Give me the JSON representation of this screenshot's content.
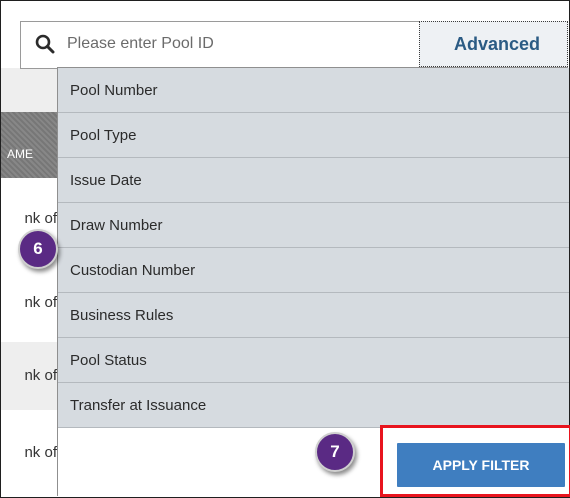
{
  "search": {
    "placeholder": "Please enter Pool ID",
    "advanced_label": "Advanced"
  },
  "background_table": {
    "header_fragment": "AME",
    "row_fragments": [
      "nk of",
      "nk of",
      "nk of",
      "nk of"
    ]
  },
  "filter_menu": {
    "items": [
      "Pool Number",
      "Pool Type",
      "Issue Date",
      "Draw Number",
      "Custodian Number",
      "Business Rules",
      "Pool Status",
      "Transfer at Issuance"
    ],
    "apply_label": "APPLY FILTER"
  },
  "callouts": {
    "step6": "6",
    "step7": "7"
  },
  "colors": {
    "accent_button": "#3f7ec0",
    "highlight_border": "#e8141e",
    "callout_badge": "#5a2a84",
    "advanced_text": "#2b5b84"
  }
}
